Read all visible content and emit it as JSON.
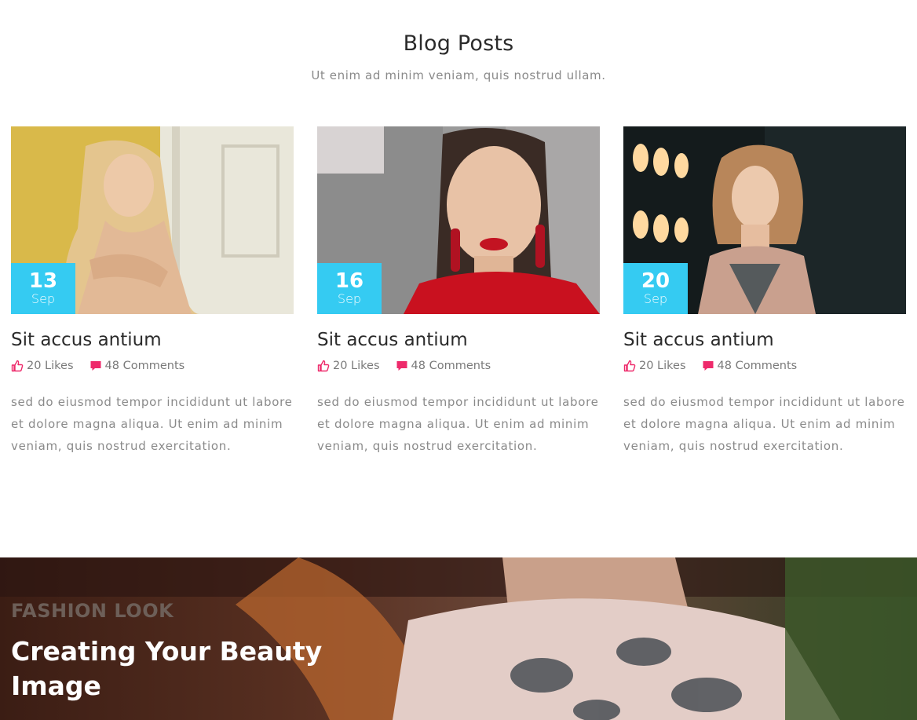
{
  "section": {
    "title": "Blog Posts",
    "subtitle": "Ut enim ad minim veniam, quis nostrud ullam."
  },
  "posts": [
    {
      "day": "13",
      "month": "Sep",
      "title": "Sit accus antium",
      "likes": "20 Likes",
      "comments": "48 Comments",
      "excerpt": "sed do eiusmod tempor incididunt ut labore et dolore magna aliqua. Ut enim ad minim veniam, quis nostrud exercitation."
    },
    {
      "day": "16",
      "month": "Sep",
      "title": "Sit accus antium",
      "likes": "20 Likes",
      "comments": "48 Comments",
      "excerpt": "sed do eiusmod tempor incididunt ut labore et dolore magna aliqua. Ut enim ad minim veniam, quis nostrud exercitation."
    },
    {
      "day": "20",
      "month": "Sep",
      "title": "Sit accus antium",
      "likes": "20 Likes",
      "comments": "48 Comments",
      "excerpt": "sed do eiusmod tempor incididunt ut labore et dolore magna aliqua. Ut enim ad minim veniam, quis nostrud exercitation."
    }
  ],
  "hero": {
    "kicker": "FASHION LOOK",
    "title": "Creating Your Beauty Image"
  },
  "icons": {
    "likes": "thumbs-up-icon",
    "comments": "comment-icon"
  },
  "colors": {
    "accent": "#35cbf2",
    "icon_pink": "#ee2a6b",
    "text_muted": "#8a8a8a"
  }
}
